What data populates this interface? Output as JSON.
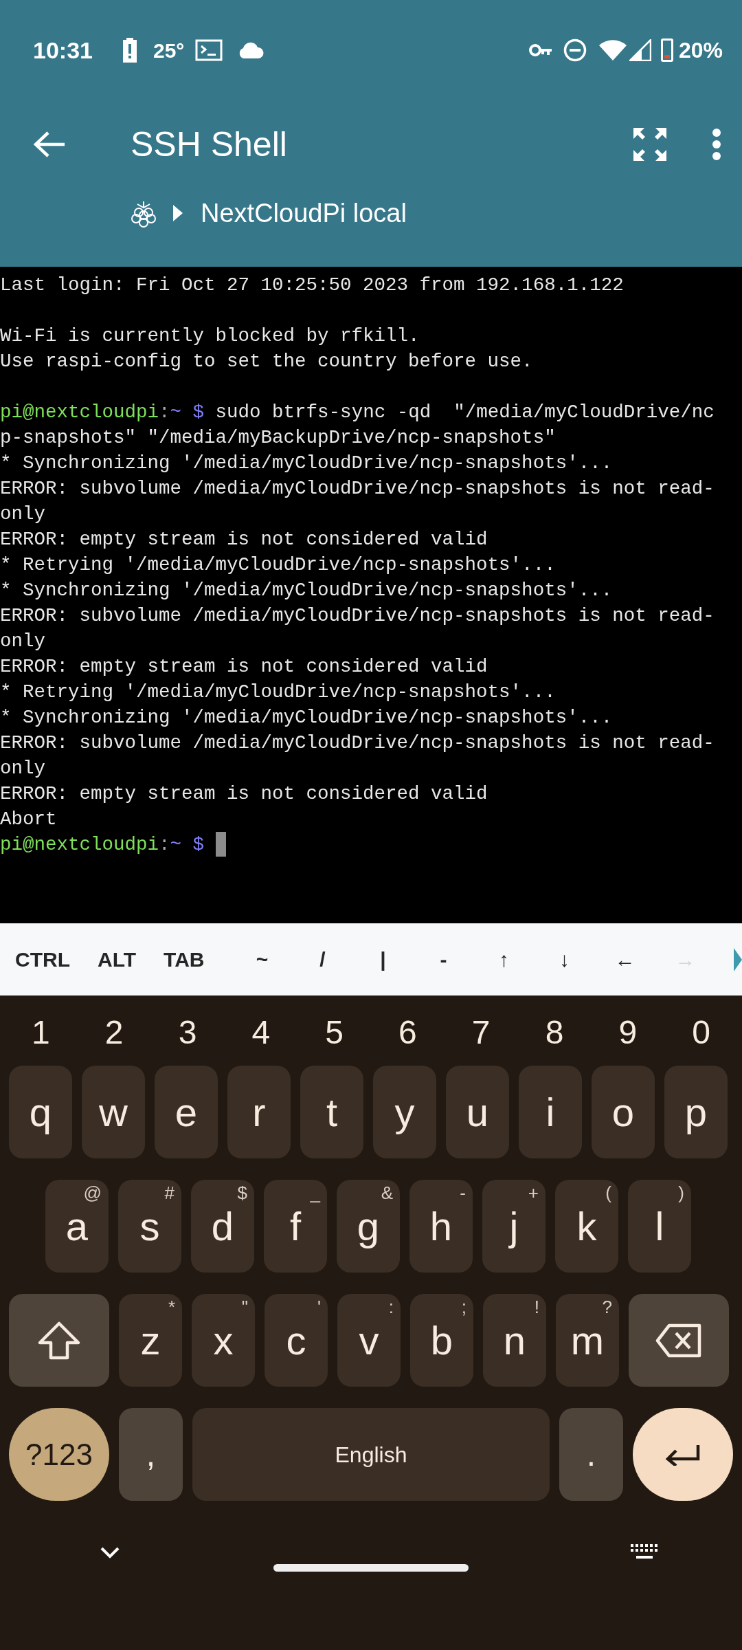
{
  "status_bar": {
    "time": "10:31",
    "temperature": "25°",
    "battery": "20%"
  },
  "app_bar": {
    "title": "SSH Shell",
    "subtitle": "NextCloudPi local"
  },
  "terminal": {
    "lines": [
      {
        "kind": "text",
        "text": "Last login: Fri Oct 27 10:25:50 2023 from 192.168.1.122"
      },
      {
        "kind": "blank"
      },
      {
        "kind": "text",
        "text": "Wi-Fi is currently blocked by rfkill."
      },
      {
        "kind": "text",
        "text": "Use raspi-config to set the country before use."
      },
      {
        "kind": "blank"
      },
      {
        "kind": "prompt",
        "user_host": "pi@nextcloudpi",
        "separator": ":",
        "path": "~",
        "symbol": "$",
        "command": "sudo btrfs-sync -qd  \"/media/myCloudDrive/nc",
        "cursor": false
      },
      {
        "kind": "text",
        "text": "p-snapshots\" \"/media/myBackupDrive/ncp-snapshots\""
      },
      {
        "kind": "text",
        "text": "* Synchronizing '/media/myCloudDrive/ncp-snapshots'..."
      },
      {
        "kind": "text",
        "text": "ERROR: subvolume /media/myCloudDrive/ncp-snapshots is not read-"
      },
      {
        "kind": "text",
        "text": "only"
      },
      {
        "kind": "text",
        "text": "ERROR: empty stream is not considered valid"
      },
      {
        "kind": "text",
        "text": "* Retrying '/media/myCloudDrive/ncp-snapshots'..."
      },
      {
        "kind": "text",
        "text": "* Synchronizing '/media/myCloudDrive/ncp-snapshots'..."
      },
      {
        "kind": "text",
        "text": "ERROR: subvolume /media/myCloudDrive/ncp-snapshots is not read-"
      },
      {
        "kind": "text",
        "text": "only"
      },
      {
        "kind": "text",
        "text": "ERROR: empty stream is not considered valid"
      },
      {
        "kind": "text",
        "text": "* Retrying '/media/myCloudDrive/ncp-snapshots'..."
      },
      {
        "kind": "text",
        "text": "* Synchronizing '/media/myCloudDrive/ncp-snapshots'..."
      },
      {
        "kind": "text",
        "text": "ERROR: subvolume /media/myCloudDrive/ncp-snapshots is not read-"
      },
      {
        "kind": "text",
        "text": "only"
      },
      {
        "kind": "text",
        "text": "ERROR: empty stream is not considered valid"
      },
      {
        "kind": "text",
        "text": "Abort"
      },
      {
        "kind": "prompt",
        "user_host": "pi@nextcloudpi",
        "separator": ":",
        "path": "~",
        "symbol": "$",
        "cursor": true
      }
    ]
  },
  "extra_keys": [
    {
      "label": "CTRL",
      "dimmed": false
    },
    {
      "label": "ALT",
      "dimmed": false
    },
    {
      "label": "TAB",
      "dimmed": false
    },
    {
      "label": "~",
      "dimmed": false
    },
    {
      "label": "/",
      "dimmed": false
    },
    {
      "label": "|",
      "dimmed": false
    },
    {
      "label": "-",
      "dimmed": false
    },
    {
      "label": "↑",
      "dimmed": false
    },
    {
      "label": "↓",
      "dimmed": false
    },
    {
      "label": "←",
      "dimmed": false
    },
    {
      "label": "→",
      "dimmed": true
    }
  ],
  "keyboard": {
    "number_row": [
      "1",
      "2",
      "3",
      "4",
      "5",
      "6",
      "7",
      "8",
      "9",
      "0"
    ],
    "rows": [
      [
        {
          "kind": "letter",
          "label": "q"
        },
        {
          "kind": "letter",
          "label": "w"
        },
        {
          "kind": "letter",
          "label": "e"
        },
        {
          "kind": "letter",
          "label": "r"
        },
        {
          "kind": "letter",
          "label": "t"
        },
        {
          "kind": "letter",
          "label": "y"
        },
        {
          "kind": "letter",
          "label": "u"
        },
        {
          "kind": "letter",
          "label": "i"
        },
        {
          "kind": "letter",
          "label": "o"
        },
        {
          "kind": "letter",
          "label": "p"
        }
      ],
      [
        {
          "kind": "letter",
          "label": "a",
          "hint": "@"
        },
        {
          "kind": "letter",
          "label": "s",
          "hint": "#"
        },
        {
          "kind": "letter",
          "label": "d",
          "hint": "$"
        },
        {
          "kind": "letter",
          "label": "f",
          "hint": "_"
        },
        {
          "kind": "letter",
          "label": "g",
          "hint": "&"
        },
        {
          "kind": "letter",
          "label": "h",
          "hint": "-"
        },
        {
          "kind": "letter",
          "label": "j",
          "hint": "+"
        },
        {
          "kind": "letter",
          "label": "k",
          "hint": "("
        },
        {
          "kind": "letter",
          "label": "l",
          "hint": ")"
        }
      ],
      [
        {
          "kind": "shift"
        },
        {
          "kind": "letter",
          "label": "z",
          "hint": "*"
        },
        {
          "kind": "letter",
          "label": "x",
          "hint": "\""
        },
        {
          "kind": "letter",
          "label": "c",
          "hint": "'"
        },
        {
          "kind": "letter",
          "label": "v",
          "hint": ":"
        },
        {
          "kind": "letter",
          "label": "b",
          "hint": ";"
        },
        {
          "kind": "letter",
          "label": "n",
          "hint": "!"
        },
        {
          "kind": "letter",
          "label": "m",
          "hint": "?"
        },
        {
          "kind": "backspace"
        }
      ]
    ],
    "bottom_row": [
      {
        "kind": "symbols",
        "label": "?123"
      },
      {
        "kind": "punct",
        "label": ","
      },
      {
        "kind": "space",
        "label": "English"
      },
      {
        "kind": "punct",
        "label": "."
      },
      {
        "kind": "enter"
      }
    ]
  }
}
